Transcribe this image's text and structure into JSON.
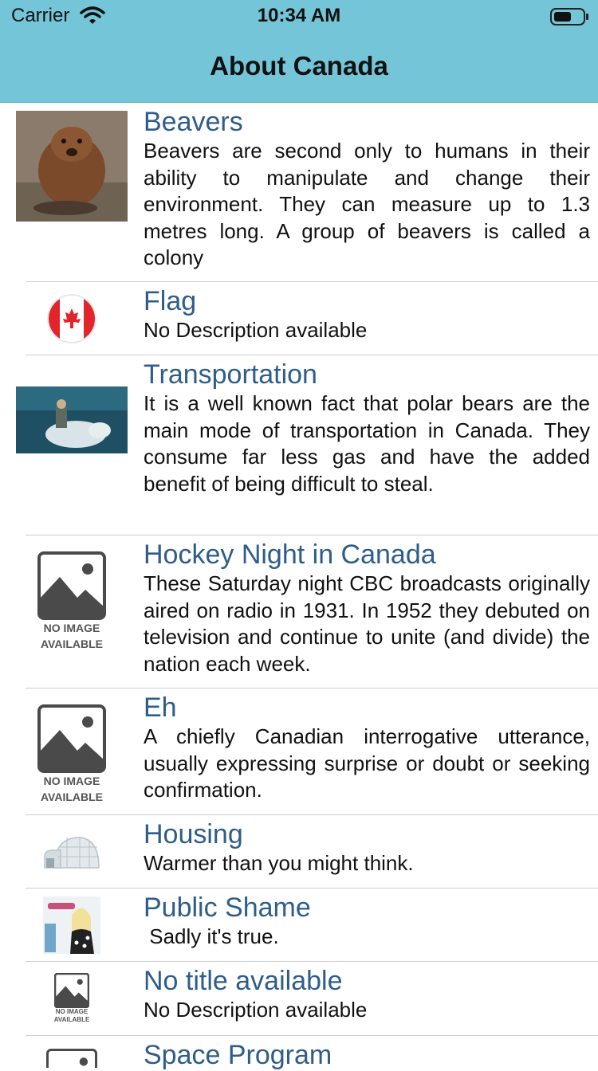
{
  "status_bar": {
    "carrier": "Carrier",
    "time": "10:34 AM"
  },
  "nav": {
    "title": "About Canada"
  },
  "rows": [
    {
      "title": "Beavers",
      "description": "Beavers are second only to humans in their ability to manipulate and change their environment. They can measure up to 1.3 metres long. A group of beavers is called a colony",
      "thumbnail": "beaver-photo"
    },
    {
      "title": "Flag",
      "description": "No Description available",
      "thumbnail": "canada-flag-icon"
    },
    {
      "title": "Transportation",
      "description": "It is a well known fact that polar bears are the main mode of transportation in Canada. They consume far less gas and have the added benefit of being difficult to steal.",
      "thumbnail": "polar-bear-photo"
    },
    {
      "title": "Hockey Night in Canada",
      "description": "These Saturday night CBC broadcasts originally aired on radio in 1931. In 1952 they debuted on television and continue to unite (and divide) the nation each week.",
      "thumbnail": "no-image-placeholder",
      "thumb_label": [
        "NO IMAGE",
        "AVAILABLE"
      ]
    },
    {
      "title": "Eh",
      "description": "A chiefly Canadian interrogative utterance, usually expressing surprise or doubt or seeking confirmation.",
      "thumbnail": "no-image-placeholder",
      "thumb_label": [
        "NO IMAGE",
        "AVAILABLE"
      ]
    },
    {
      "title": "Housing",
      "description": "Warmer than you might think.",
      "thumbnail": "igloo-image"
    },
    {
      "title": "Public Shame",
      "description": " Sadly it's true.",
      "thumbnail": "album-cover-image"
    },
    {
      "title": "No title available",
      "description": "No Description available",
      "thumbnail": "no-image-placeholder-small",
      "thumb_label": [
        "NO IMAGE",
        "AVAILABLE"
      ]
    },
    {
      "title": "Space Program",
      "description": "",
      "thumbnail": "no-image-placeholder"
    }
  ],
  "colors": {
    "nav_background": "#75c5d9",
    "title_text": "#2f5d8a"
  }
}
